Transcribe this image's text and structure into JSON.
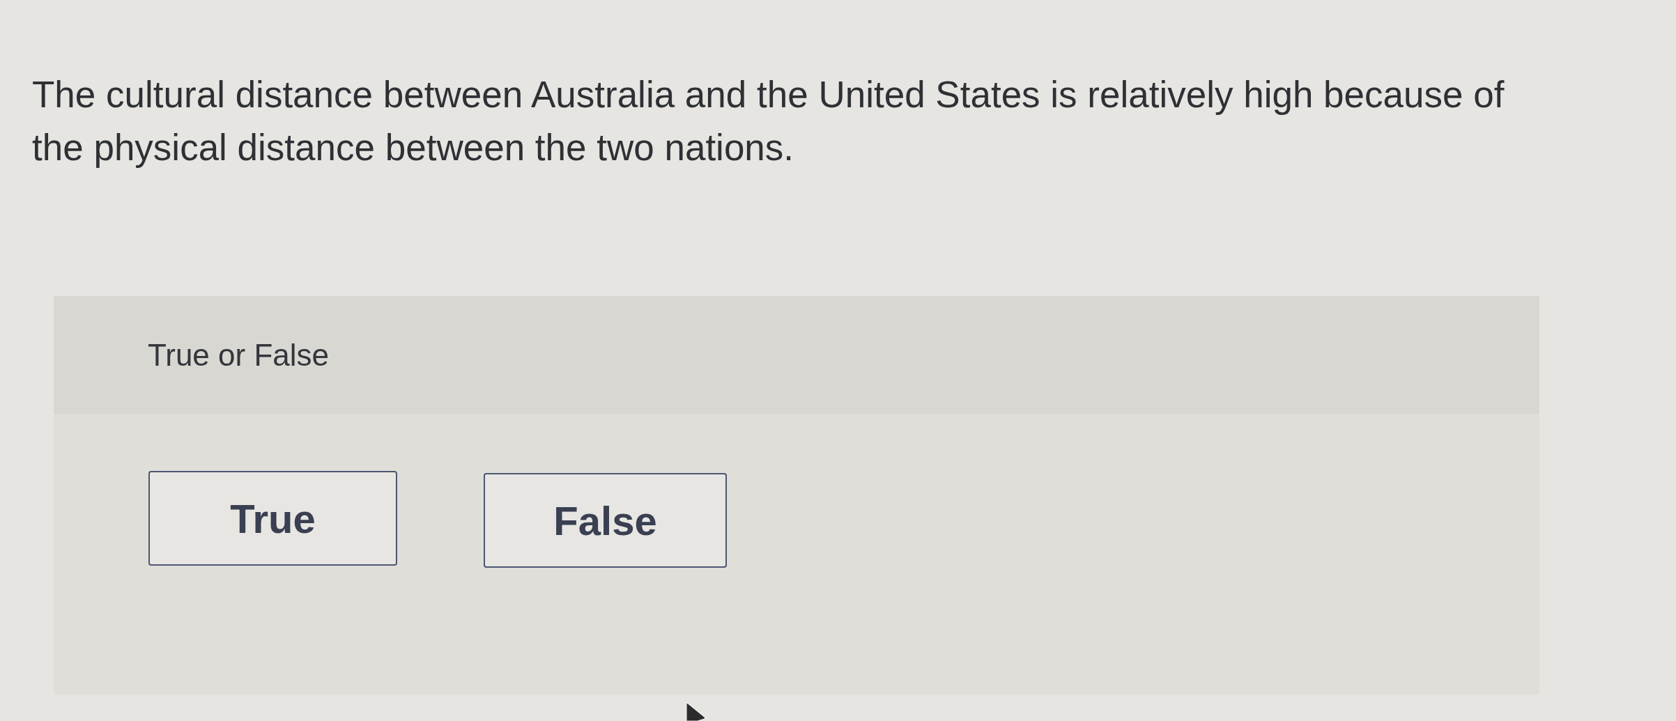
{
  "question": {
    "text": "The cultural distance between Australia and the United States is relatively high because of the physical distance between the two nations."
  },
  "answer_panel": {
    "prompt": "True or False",
    "options": [
      {
        "label": "True",
        "selected": false
      },
      {
        "label": "False",
        "selected": false
      }
    ]
  }
}
